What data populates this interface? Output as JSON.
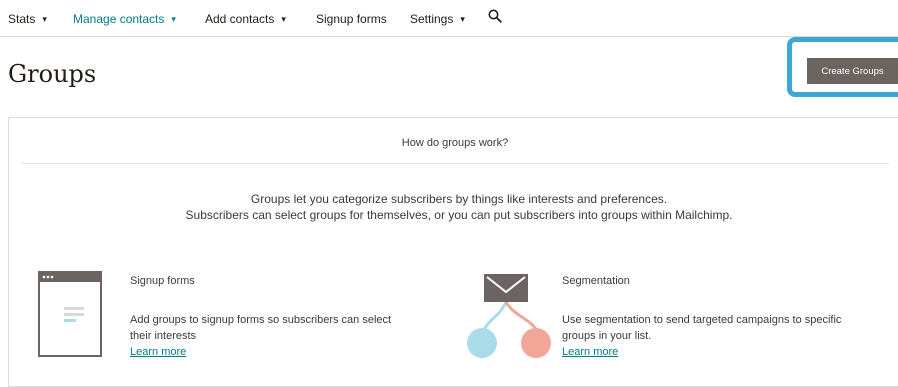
{
  "nav": {
    "items": [
      {
        "label": "Stats",
        "has_dropdown": true,
        "active": false
      },
      {
        "label": "Manage contacts",
        "has_dropdown": true,
        "active": true
      },
      {
        "label": "Add contacts",
        "has_dropdown": true,
        "active": false
      },
      {
        "label": "Signup forms",
        "has_dropdown": false,
        "active": false
      },
      {
        "label": "Settings",
        "has_dropdown": true,
        "active": false
      }
    ],
    "search_icon": "search-icon"
  },
  "page": {
    "title": "Groups",
    "create_button": "Create Groups"
  },
  "panel": {
    "header": "How do groups work?",
    "desc_line1": "Groups let you categorize subscribers by things like interests and preferences.",
    "desc_line2": "Subscribers can select groups for themselves, or you can put subscribers into groups within Mailchimp.",
    "features": [
      {
        "title": "Signup forms",
        "text_line1": "Add groups to signup forms so subscribers can select",
        "text_line2": "their interests",
        "link": "Learn more",
        "icon": "browser-form-icon"
      },
      {
        "title": "Segmentation",
        "text_line1": "Use segmentation to send targeted campaigns to specific",
        "text_line2": "groups in your list.",
        "link": "Learn more",
        "icon": "envelope-segment-icon"
      }
    ]
  },
  "colors": {
    "accent": "#007c89",
    "button": "#6b6461",
    "highlight": "#3ca7d4",
    "segment_blue": "#a9dbe8",
    "segment_pink": "#f1a697"
  }
}
